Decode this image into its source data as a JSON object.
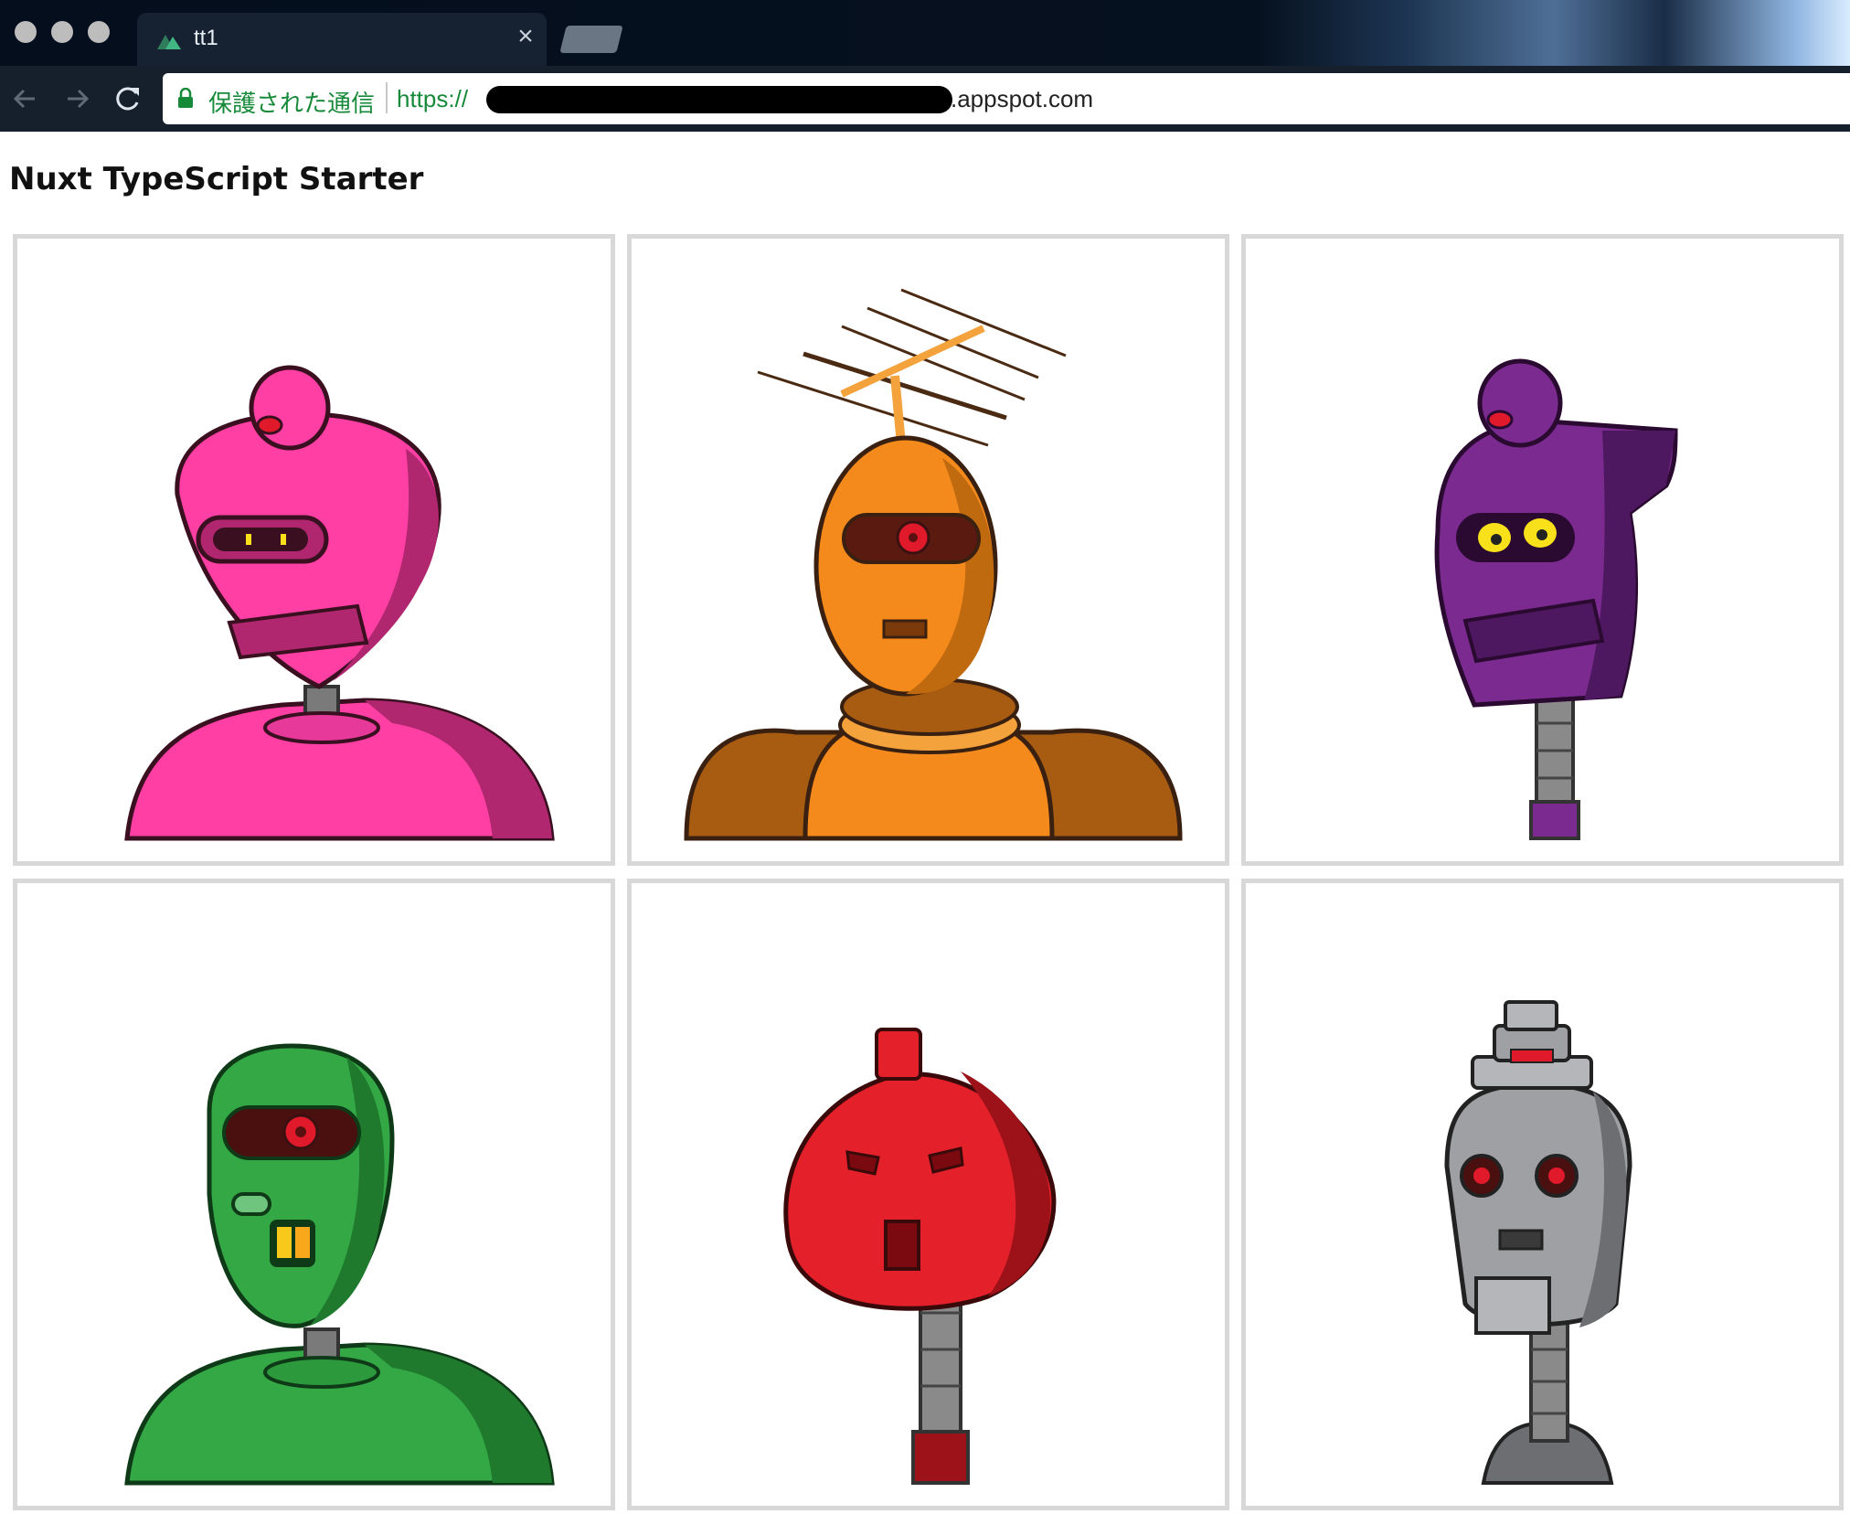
{
  "browser": {
    "tab": {
      "title": "tt1",
      "favicon": "nuxt-logo-icon"
    },
    "address_bar": {
      "security_label": "保護された通信",
      "url_scheme": "https://",
      "url_domain": ".appspot.com"
    },
    "nav_icons": [
      "back-arrow-icon",
      "forward-arrow-icon",
      "reload-icon"
    ]
  },
  "page": {
    "title": "Nuxt TypeScript Starter",
    "robots": [
      {
        "color": "pink",
        "body": "#ff3fa3",
        "dark": "#b0276f"
      },
      {
        "color": "orange",
        "body": "#f48a1c",
        "dark": "#a85c12"
      },
      {
        "color": "purple",
        "body": "#7b2a90",
        "dark": "#4e1860"
      },
      {
        "color": "green",
        "body": "#33a845",
        "dark": "#1f7a2e"
      },
      {
        "color": "red",
        "body": "#e4202a",
        "dark": "#9c1218"
      },
      {
        "color": "gray",
        "body": "#9ea0a4",
        "dark": "#6c6e72"
      }
    ]
  }
}
